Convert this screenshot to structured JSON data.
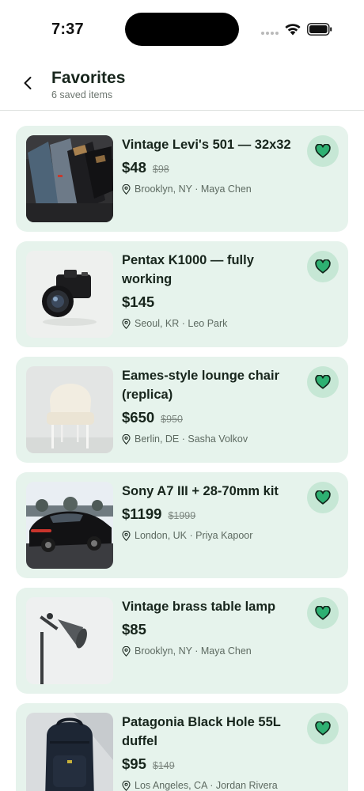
{
  "status_bar": {
    "time": "7:37"
  },
  "header": {
    "title": "Favorites",
    "subtitle": "6 saved items"
  },
  "colors": {
    "card_bg": "#e6f3ec",
    "heart_fill": "#2eb072",
    "heart_bg": "#c6e7d5",
    "text": "#17251c"
  },
  "items": [
    {
      "title": "Vintage Levi's 501 — 32x32",
      "price": "$48",
      "old_price": "$98",
      "location": "Brooklyn, NY · Maya Chen",
      "image": "jeans-photo"
    },
    {
      "title": "Pentax K1000 — fully working",
      "price": "$145",
      "old_price": "",
      "location": "Seoul, KR · Leo Park",
      "image": "camera-photo"
    },
    {
      "title": "Eames-style lounge chair (replica)",
      "price": "$650",
      "old_price": "$950",
      "location": "Berlin, DE · Sasha Volkov",
      "image": "chair-photo"
    },
    {
      "title": "Sony A7 III + 28-70mm kit",
      "price": "$1199",
      "old_price": "$1999",
      "location": "London, UK · Priya Kapoor",
      "image": "car-photo"
    },
    {
      "title": "Vintage brass table lamp",
      "price": "$85",
      "old_price": "",
      "location": "Brooklyn, NY · Maya Chen",
      "image": "lamp-photo"
    },
    {
      "title": "Patagonia Black Hole 55L duffel",
      "price": "$95",
      "old_price": "$149",
      "location": "Los Angeles, CA · Jordan Rivera",
      "image": "backpack-photo"
    }
  ]
}
